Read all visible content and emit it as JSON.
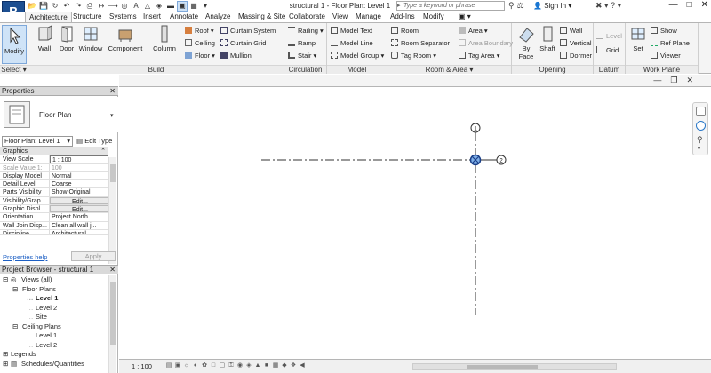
{
  "app": {
    "logo": "R",
    "document_title": "structural 1 - Floor Plan: Level 1"
  },
  "search": {
    "placeholder": "Type a keyword or phrase"
  },
  "account": {
    "signin": "Sign In",
    "help": "?"
  },
  "tabs": [
    "Architecture",
    "Structure",
    "Systems",
    "Insert",
    "Annotate",
    "Analyze",
    "Massing & Site",
    "Collaborate",
    "View",
    "Manage",
    "Add-Ins",
    "Modify"
  ],
  "ribbon": {
    "select": {
      "label": "Select",
      "modify": "Modify"
    },
    "build": {
      "label": "Build",
      "wall": "Wall",
      "door": "Door",
      "window": "Window",
      "component": "Component",
      "column": "Column",
      "roof": "Roof",
      "ceiling": "Ceiling",
      "floor": "Floor",
      "curtain_system": "Curtain System",
      "curtain_grid": "Curtain Grid",
      "mullion": "Mullion"
    },
    "circulation": {
      "label": "Circulation",
      "railing": "Railing",
      "ramp": "Ramp",
      "stair": "Stair"
    },
    "model": {
      "label": "Model",
      "model_text": "Model Text",
      "model_line": "Model Line",
      "model_group": "Model Group"
    },
    "room_area": {
      "label": "Room & Area",
      "room": "Room",
      "room_separator": "Room Separator",
      "tag_room": "Tag Room",
      "area": "Area",
      "area_boundary": "Area Boundary",
      "tag_area": "Tag Area"
    },
    "opening": {
      "label": "Opening",
      "by_face": "By Face",
      "shaft": "Shaft",
      "wall": "Wall",
      "vertical": "Vertical",
      "dormer": "Dormer"
    },
    "datum": {
      "label": "Datum",
      "level": "Level",
      "grid": "Grid"
    },
    "work_plane": {
      "label": "Work Plane",
      "set": "Set",
      "show": "Show",
      "ref_plane": "Ref Plane",
      "viewer": "Viewer"
    }
  },
  "properties": {
    "title": "Properties",
    "type_name": "Floor Plan",
    "filter": "Floor Plan: Level 1",
    "edit_type": "Edit Type",
    "group": "Graphics",
    "rows": [
      {
        "k": "View Scale",
        "v": "1 : 100"
      },
      {
        "k": "Scale Value    1:",
        "v": "100"
      },
      {
        "k": "Display Model",
        "v": "Normal"
      },
      {
        "k": "Detail Level",
        "v": "Coarse"
      },
      {
        "k": "Parts Visibility",
        "v": "Show Original"
      },
      {
        "k": "Visibility/Grap...",
        "v": "Edit..."
      },
      {
        "k": "Graphic Displ...",
        "v": "Edit..."
      },
      {
        "k": "Orientation",
        "v": "Project North"
      },
      {
        "k": "Wall Join Disp...",
        "v": "Clean all wall j..."
      },
      {
        "k": "Discipline",
        "v": "Architectural"
      }
    ],
    "help_link": "Properties help",
    "apply": "Apply"
  },
  "browser": {
    "title": "Project Browser - structural 1",
    "items": [
      "Views (all)",
      "Floor Plans",
      "Level 1",
      "Level 2",
      "Site",
      "Ceiling Plans",
      "Level 1",
      "Level 2",
      "Legends",
      "Schedules/Quantities"
    ]
  },
  "grid": {
    "bubble_1": "1",
    "bubble_2": "2"
  },
  "status": {
    "scale": "1 : 100"
  }
}
